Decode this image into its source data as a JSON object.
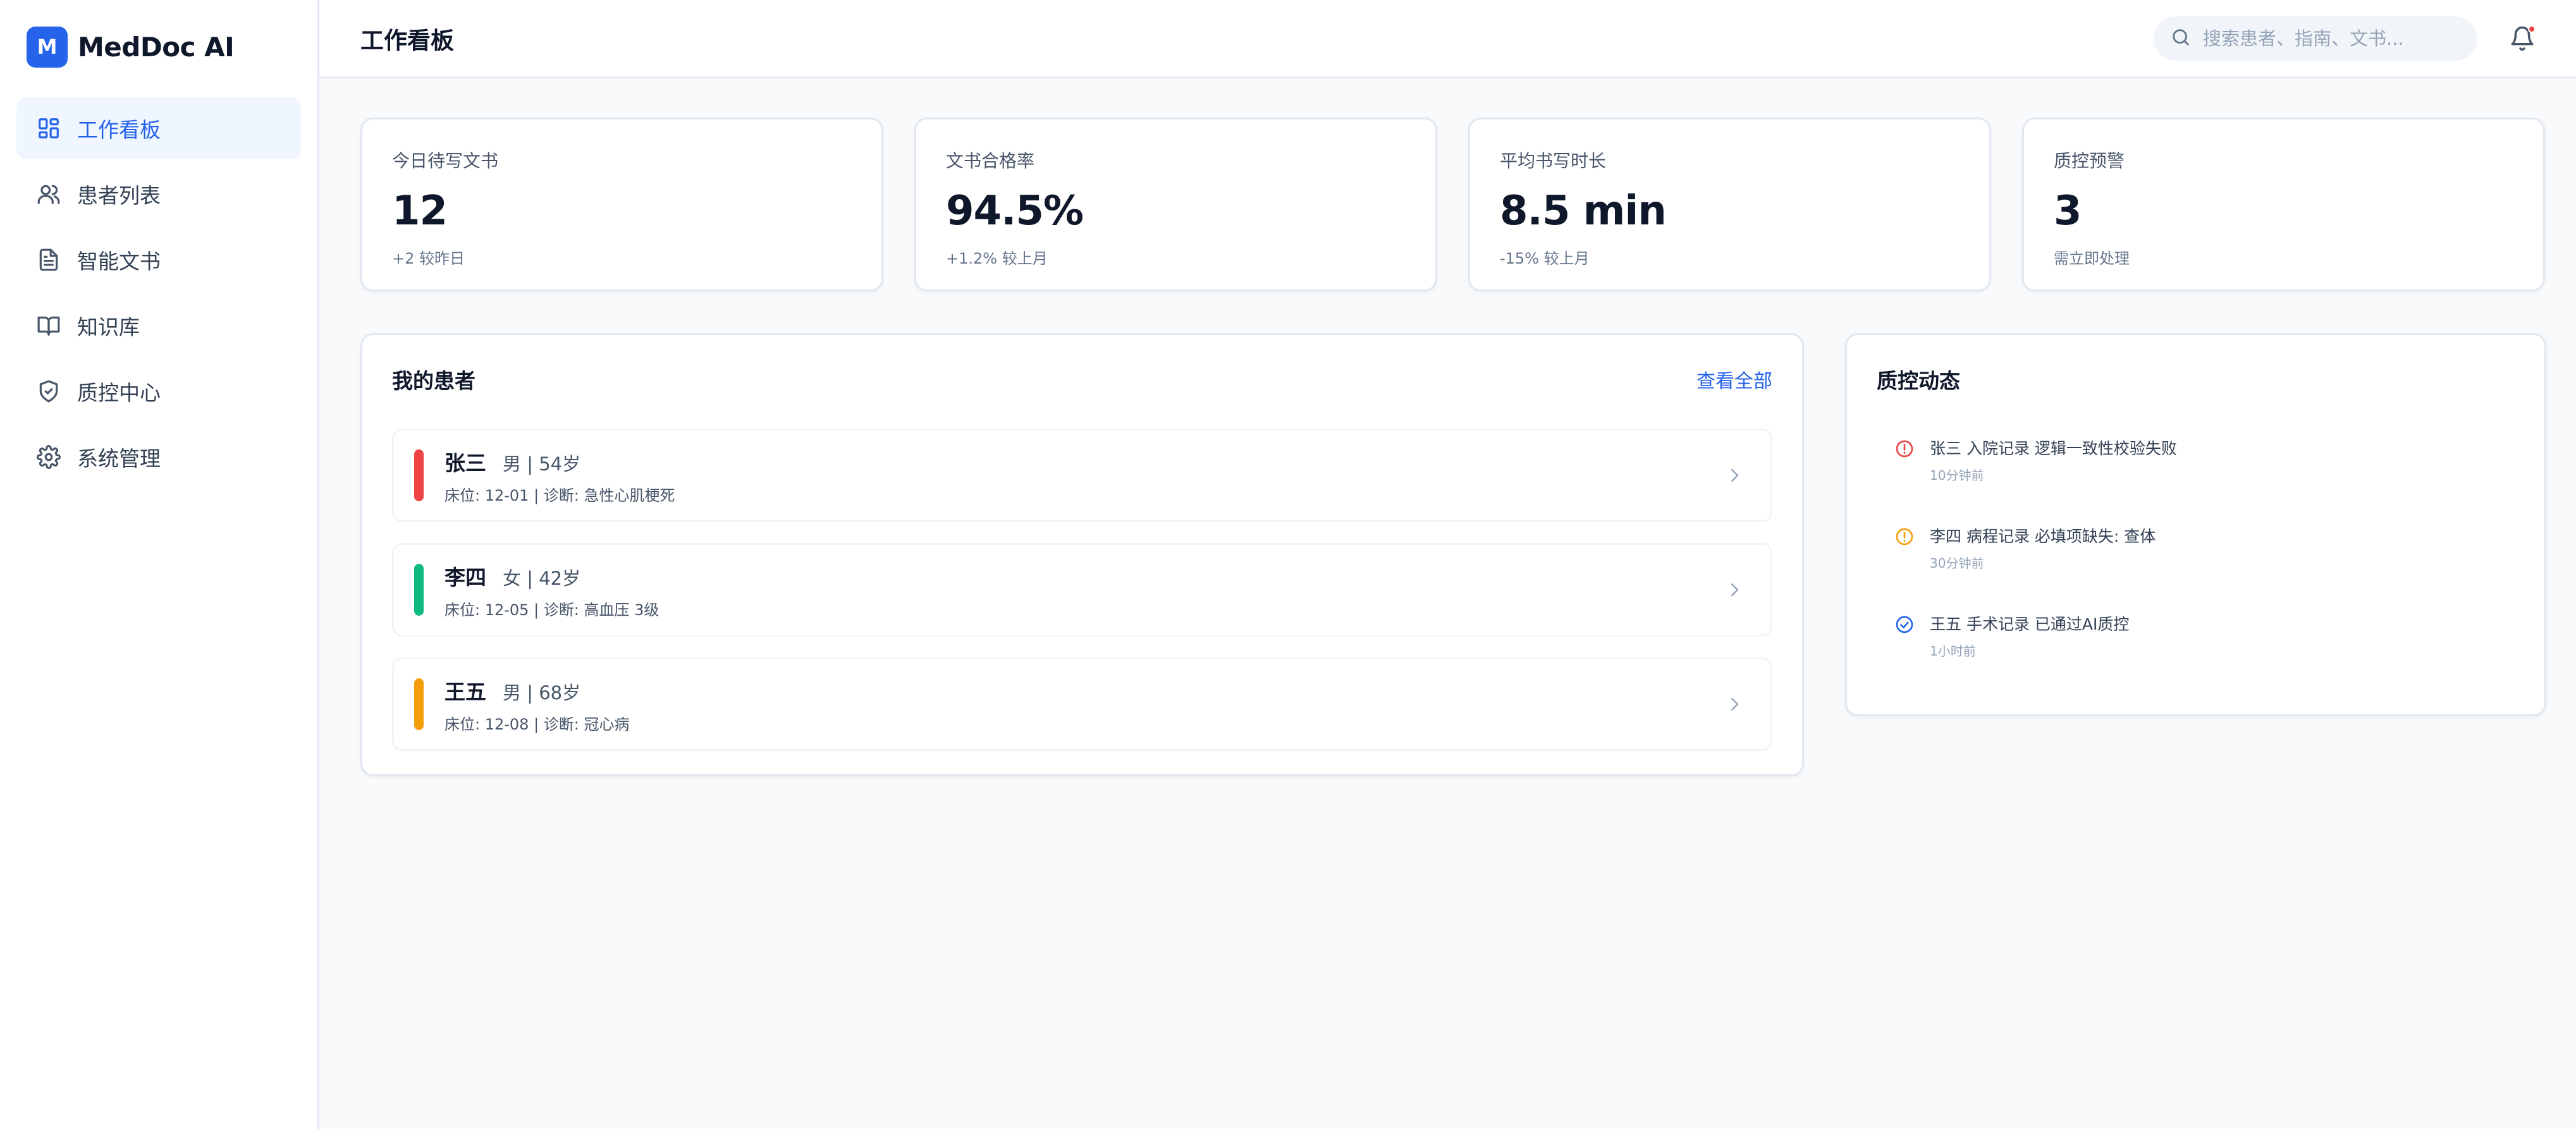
{
  "brand": {
    "logo_letter": "M",
    "name": "MedDoc AI",
    "accent": "#2563eb"
  },
  "sidebar": {
    "items": [
      {
        "label": "工作看板",
        "icon": "dashboard-icon",
        "active": true
      },
      {
        "label": "患者列表",
        "icon": "users-icon"
      },
      {
        "label": "智能文书",
        "icon": "document-icon"
      },
      {
        "label": "知识库",
        "icon": "book-icon"
      },
      {
        "label": "质控中心",
        "icon": "shield-check-icon"
      },
      {
        "label": "系统管理",
        "icon": "gear-icon"
      }
    ]
  },
  "header": {
    "title": "工作看板",
    "search_placeholder": "搜索患者、指南、文书...",
    "search_value": "",
    "notification_dot_color": "#ef4444"
  },
  "stats": [
    {
      "label": "今日待写文书",
      "value": "12",
      "sub": "+2 较昨日"
    },
    {
      "label": "文书合格率",
      "value": "94.5%",
      "sub": "+1.2% 较上月"
    },
    {
      "label": "平均书写时长",
      "value": "8.5 min",
      "sub": "-15% 较上月"
    },
    {
      "label": "质控预警",
      "value": "3",
      "sub": "需立即处理"
    }
  ],
  "patients": {
    "title": "我的患者",
    "view_all": "查看全部",
    "rows": [
      {
        "name": "张三",
        "meta": "男 | 54岁",
        "detail": "床位: 12-01 | 诊断: 急性心肌梗死",
        "color": "#ef4444"
      },
      {
        "name": "李四",
        "meta": "女 | 42岁",
        "detail": "床位: 12-05 | 诊断: 高血压 3级",
        "color": "#10b981"
      },
      {
        "name": "王五",
        "meta": "男 | 68岁",
        "detail": "床位: 12-08 | 诊断: 冠心病",
        "color": "#f59e0b"
      }
    ]
  },
  "qc": {
    "title": "质控动态",
    "items": [
      {
        "icon": "alert-circle-icon",
        "color": "#ef4444",
        "text": "张三 入院记录 逻辑一致性校验失败",
        "time": "10分钟前"
      },
      {
        "icon": "alert-circle-icon",
        "color": "#f59e0b",
        "text": "李四 病程记录 必填项缺失: 查体",
        "time": "30分钟前"
      },
      {
        "icon": "check-circle-icon",
        "color": "#2563eb",
        "text": "王五 手术记录 已通过AI质控",
        "time": "1小时前"
      }
    ]
  }
}
